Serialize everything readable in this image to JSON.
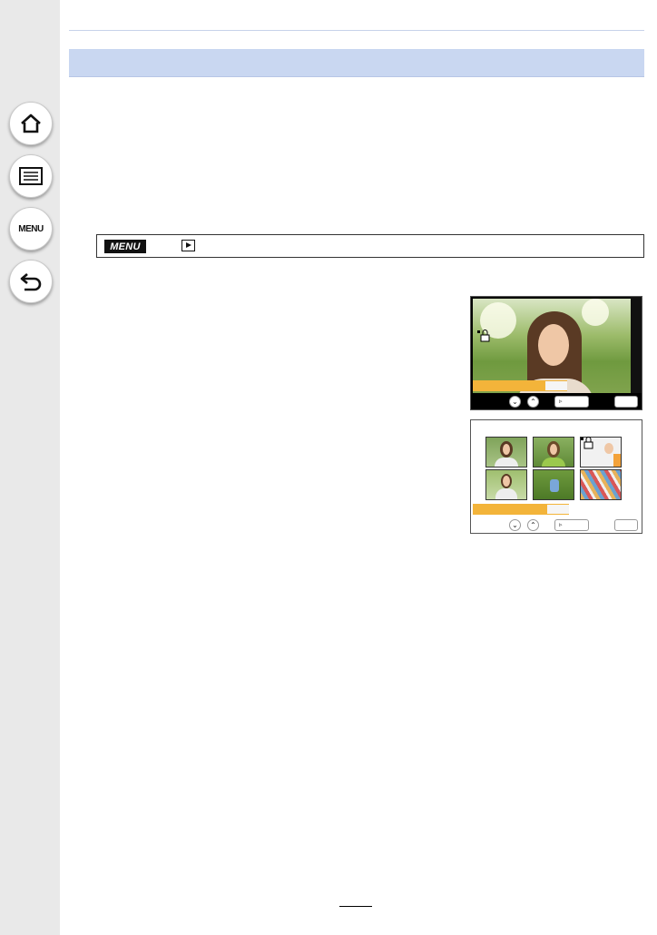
{
  "sidebar": {
    "home_icon": "home-icon",
    "contents_icon": "list-icon",
    "menu_label": "MENU",
    "back_icon": "back-arrow-icon"
  },
  "path_bar": {
    "menu_badge": "MENU",
    "arrow1": "→",
    "playback_icon": "playback-icon"
  },
  "screen1": {
    "accent": "#f3b43a",
    "icons": [
      "protect-lock-icon",
      "down-button-icon",
      "up-button-icon",
      "play-button-icon",
      "set-button-icon"
    ]
  },
  "screen2": {
    "accent": "#f3b43a",
    "thumbnail_count": 6,
    "icons": [
      "protect-lock-icon",
      "down-button-icon",
      "up-button-icon",
      "play-button-icon",
      "set-button-icon"
    ]
  },
  "colors": {
    "banner": "#c9d7f1",
    "sidebar": "#e9e9e9"
  }
}
